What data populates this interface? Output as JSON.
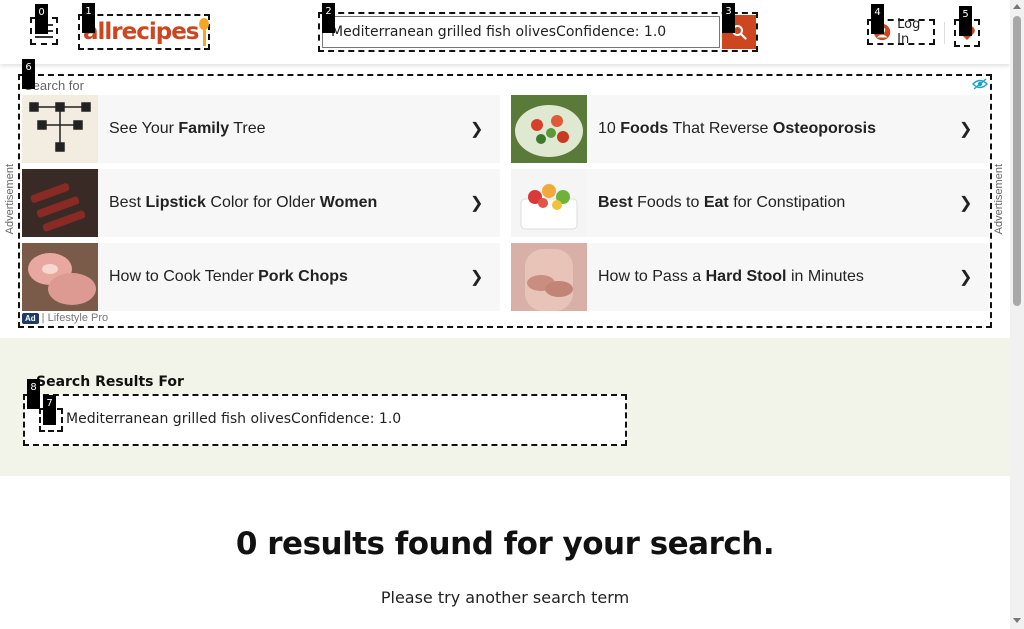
{
  "header": {
    "logo_text": "allrecipes",
    "search_value": "Mediterranean grilled fish olivesConfidence: 1.0",
    "login_label": "Log In"
  },
  "ad": {
    "search_for": "Search for",
    "side_label": "Advertisement",
    "badge": "Ad",
    "sponsor": "| Lifestyle Pro",
    "items": [
      {
        "parts": [
          {
            "t": "See Your "
          },
          {
            "t": "Family",
            "b": true
          },
          {
            "t": " Tree"
          }
        ]
      },
      {
        "parts": [
          {
            "t": "10 "
          },
          {
            "t": "Foods",
            "b": true
          },
          {
            "t": " That Reverse "
          },
          {
            "t": "Osteoporosis",
            "b": true
          }
        ]
      },
      {
        "parts": [
          {
            "t": "Best "
          },
          {
            "t": "Lipstick",
            "b": true
          },
          {
            "t": " Color for Older "
          },
          {
            "t": "Women",
            "b": true
          }
        ]
      },
      {
        "parts": [
          {
            "t": "Best",
            "b": true
          },
          {
            "t": " Foods to "
          },
          {
            "t": "Eat",
            "b": true
          },
          {
            "t": " for Constipation"
          }
        ]
      },
      {
        "parts": [
          {
            "t": "How to Cook Tender "
          },
          {
            "t": "Pork Chops",
            "b": true
          }
        ]
      },
      {
        "parts": [
          {
            "t": "How to Pass a "
          },
          {
            "t": "Hard Stool",
            "b": true
          },
          {
            "t": " in Minutes"
          }
        ]
      }
    ],
    "arrow": "❯"
  },
  "results": {
    "title": "Search Results For",
    "query": "Mediterranean grilled fish olivesConfidence: 1.0",
    "none_found": "0 results found for your search.",
    "try_again": "Please try another search term"
  },
  "marks": [
    "0",
    "1",
    "2",
    "3",
    "4",
    "5",
    "6",
    "7",
    "8"
  ],
  "colors": {
    "brand": "#ce4620",
    "band": "#f2f4e9"
  }
}
